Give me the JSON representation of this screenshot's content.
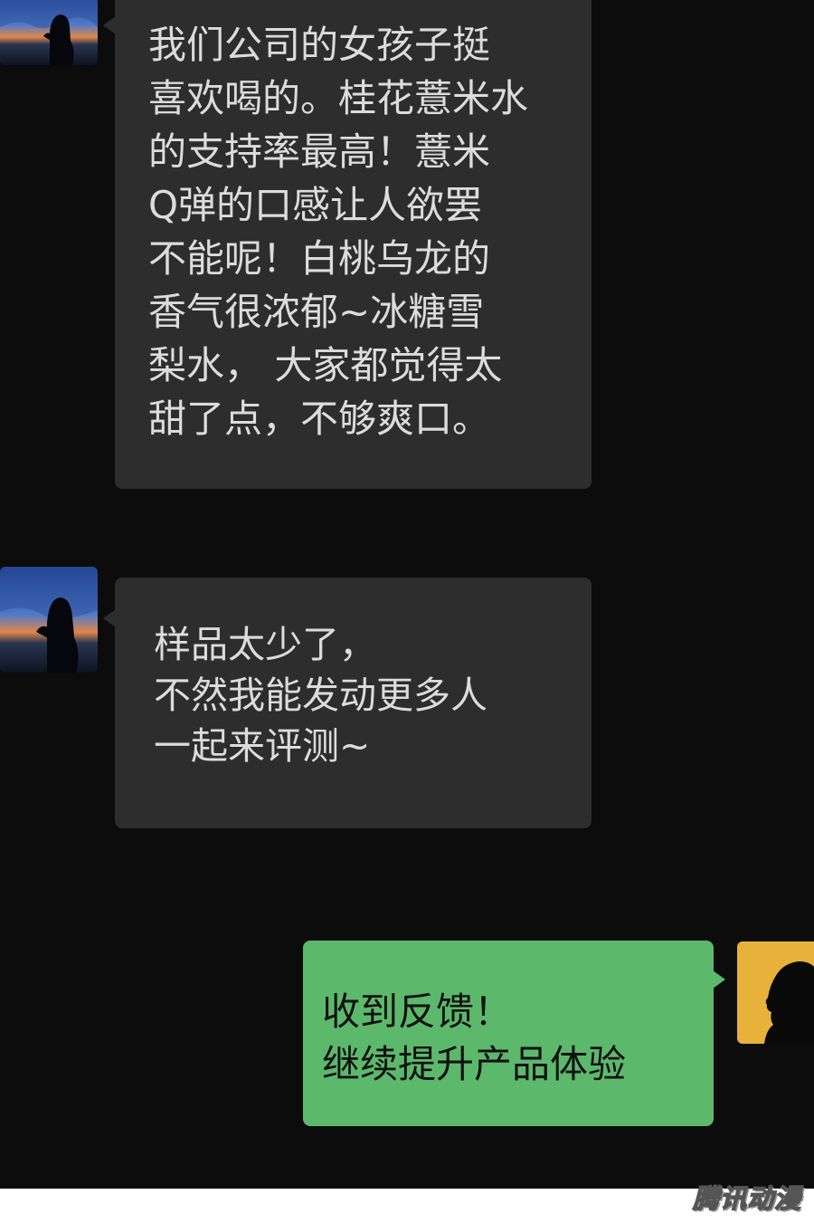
{
  "conversation": {
    "messages": [
      {
        "sender": "contact",
        "avatar_icon": "sunset-silhouette-avatar-icon",
        "text": "我们公司的女孩子挺\n喜欢喝的。桂花薏米水\n的支持率最高！薏米\nQ弹的口感让人欲罢\n不能呢！白桃乌龙的\n香气很浓郁~冰糖雪\n梨水， 大家都觉得太\n甜了点，不够爽口。"
      },
      {
        "sender": "contact",
        "avatar_icon": "sunset-silhouette-avatar-icon",
        "text": "样品太少了，\n不然我能发动更多人\n一起来评测~"
      },
      {
        "sender": "self",
        "avatar_icon": "man-silhouette-avatar-icon",
        "text": "收到反馈！\n继续提升产品体验"
      }
    ]
  },
  "watermark": {
    "text": "腾讯动漫"
  },
  "colors": {
    "chat_background": "#0c0c0c",
    "incoming_bubble": "#2d2d2d",
    "incoming_text": "#dcdcdc",
    "outgoing_bubble": "#5cb96c",
    "outgoing_text": "#111111",
    "self_avatar_background": "#e8b23a"
  }
}
